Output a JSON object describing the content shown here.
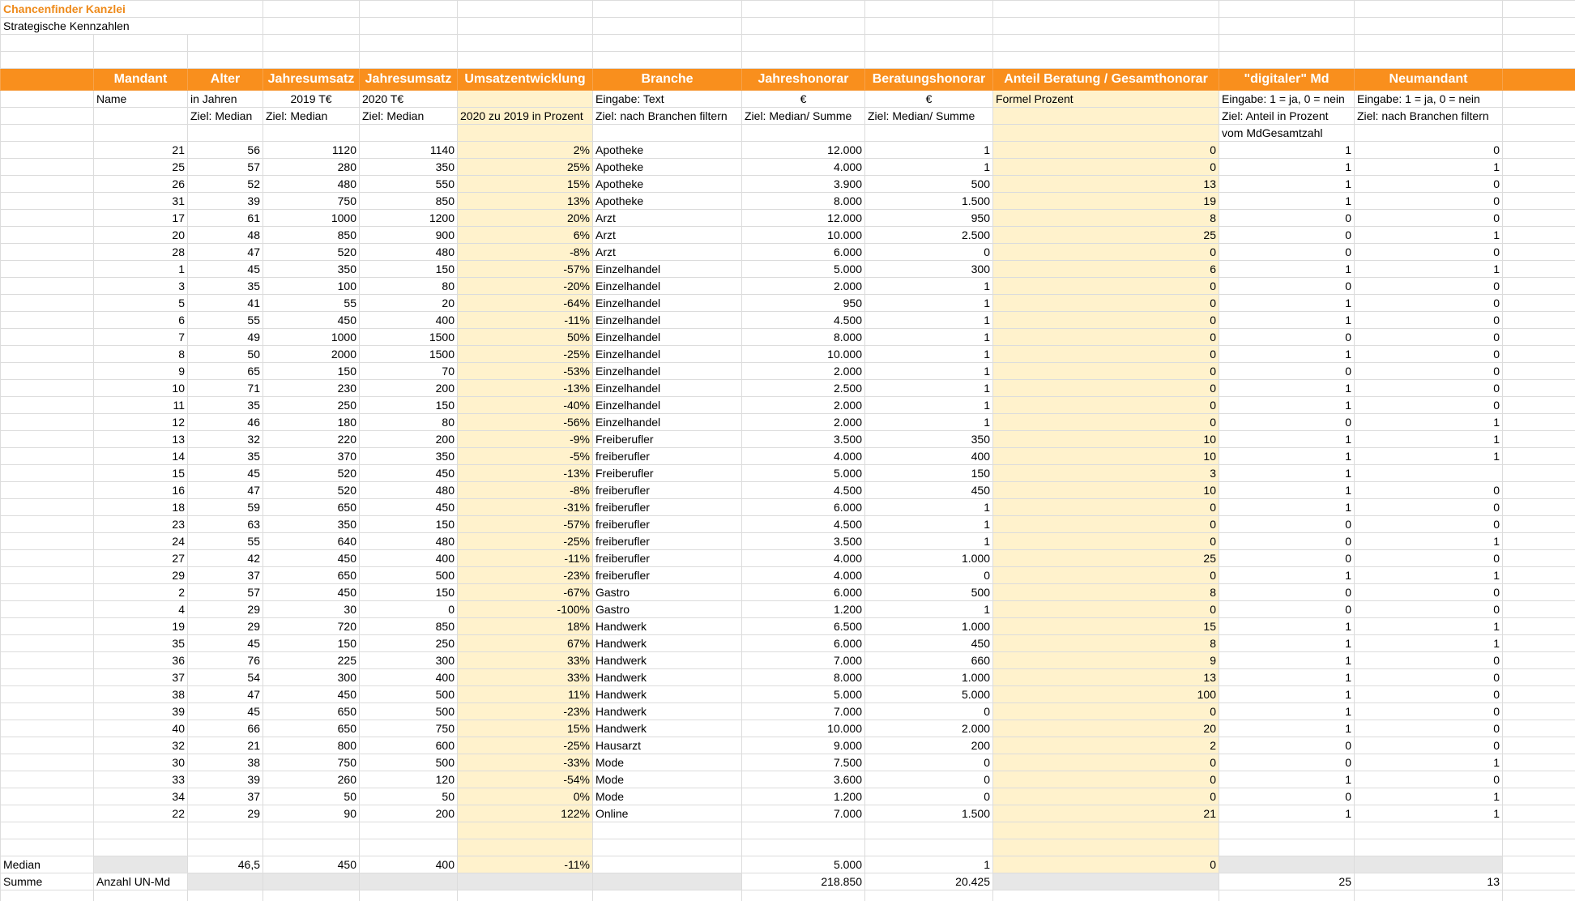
{
  "sheet": {
    "title": "Chancenfinder Kanzlei",
    "subtitle": "Strategische Kennzahlen",
    "headers": [
      "Mandant",
      "Alter",
      "Jahresumsatz",
      "Jahresumsatz",
      "Umsatzentwicklung",
      "Branche",
      "Jahreshonorar",
      "Beratungshonorar",
      "Anteil Beratung / Gesamthonorar",
      "\"digitaler\" Md",
      "Neumandant"
    ],
    "units_row": [
      "Name",
      "in Jahren",
      "2019   T€",
      "2020 T€",
      "",
      "Eingabe: Text",
      "€",
      "€",
      "Formel Prozent",
      "Eingabe: 1 = ja, 0 = nein",
      "Eingabe: 1 = ja, 0 = nein"
    ],
    "target_row": [
      "",
      "Ziel: Median",
      "Ziel: Median",
      "Ziel: Median",
      "2020 zu 2019 in Prozent",
      "Ziel: nach Branchen filtern",
      "Ziel: Median/ Summe",
      "Ziel: Median/ Summe",
      "",
      "Ziel: Anteil in Prozent",
      "Ziel: nach Branchen filtern"
    ],
    "target_row2": [
      "",
      "",
      "",
      "",
      "",
      "",
      "",
      "",
      "",
      "vom MdGesamtzahl",
      ""
    ],
    "rows": [
      [
        "21",
        "56",
        "1120",
        "1140",
        "2%",
        "Apotheke",
        "12.000",
        "1",
        "0",
        "1",
        "0"
      ],
      [
        "25",
        "57",
        "280",
        "350",
        "25%",
        "Apotheke",
        "4.000",
        "1",
        "0",
        "1",
        "1"
      ],
      [
        "26",
        "52",
        "480",
        "550",
        "15%",
        "Apotheke",
        "3.900",
        "500",
        "13",
        "1",
        "0"
      ],
      [
        "31",
        "39",
        "750",
        "850",
        "13%",
        "Apotheke",
        "8.000",
        "1.500",
        "19",
        "1",
        "0"
      ],
      [
        "17",
        "61",
        "1000",
        "1200",
        "20%",
        "Arzt",
        "12.000",
        "950",
        "8",
        "0",
        "0"
      ],
      [
        "20",
        "48",
        "850",
        "900",
        "6%",
        "Arzt",
        "10.000",
        "2.500",
        "25",
        "0",
        "1"
      ],
      [
        "28",
        "47",
        "520",
        "480",
        "-8%",
        "Arzt",
        "6.000",
        "0",
        "0",
        "0",
        "0"
      ],
      [
        "1",
        "45",
        "350",
        "150",
        "-57%",
        "Einzelhandel",
        "5.000",
        "300",
        "6",
        "1",
        "1"
      ],
      [
        "3",
        "35",
        "100",
        "80",
        "-20%",
        "Einzelhandel",
        "2.000",
        "1",
        "0",
        "0",
        "0"
      ],
      [
        "5",
        "41",
        "55",
        "20",
        "-64%",
        "Einzelhandel",
        "950",
        "1",
        "0",
        "1",
        "0"
      ],
      [
        "6",
        "55",
        "450",
        "400",
        "-11%",
        "Einzelhandel",
        "4.500",
        "1",
        "0",
        "1",
        "0"
      ],
      [
        "7",
        "49",
        "1000",
        "1500",
        "50%",
        "Einzelhandel",
        "8.000",
        "1",
        "0",
        "0",
        "0"
      ],
      [
        "8",
        "50",
        "2000",
        "1500",
        "-25%",
        "Einzelhandel",
        "10.000",
        "1",
        "0",
        "1",
        "0"
      ],
      [
        "9",
        "65",
        "150",
        "70",
        "-53%",
        "Einzelhandel",
        "2.000",
        "1",
        "0",
        "0",
        "0"
      ],
      [
        "10",
        "71",
        "230",
        "200",
        "-13%",
        "Einzelhandel",
        "2.500",
        "1",
        "0",
        "1",
        "0"
      ],
      [
        "11",
        "35",
        "250",
        "150",
        "-40%",
        "Einzelhandel",
        "2.000",
        "1",
        "0",
        "1",
        "0"
      ],
      [
        "12",
        "46",
        "180",
        "80",
        "-56%",
        "Einzelhandel",
        "2.000",
        "1",
        "0",
        "0",
        "1"
      ],
      [
        "13",
        "32",
        "220",
        "200",
        "-9%",
        "Freiberufler",
        "3.500",
        "350",
        "10",
        "1",
        "1"
      ],
      [
        "14",
        "35",
        "370",
        "350",
        "-5%",
        "freiberufler",
        "4.000",
        "400",
        "10",
        "1",
        "1"
      ],
      [
        "15",
        "45",
        "520",
        "450",
        "-13%",
        "Freiberufler",
        "5.000",
        "150",
        "3",
        "1",
        ""
      ],
      [
        "16",
        "47",
        "520",
        "480",
        "-8%",
        "freiberufler",
        "4.500",
        "450",
        "10",
        "1",
        "0"
      ],
      [
        "18",
        "59",
        "650",
        "450",
        "-31%",
        "freiberufler",
        "6.000",
        "1",
        "0",
        "1",
        "0"
      ],
      [
        "23",
        "63",
        "350",
        "150",
        "-57%",
        "freiberufler",
        "4.500",
        "1",
        "0",
        "0",
        "0"
      ],
      [
        "24",
        "55",
        "640",
        "480",
        "-25%",
        "freiberufler",
        "3.500",
        "1",
        "0",
        "0",
        "1"
      ],
      [
        "27",
        "42",
        "450",
        "400",
        "-11%",
        "freiberufler",
        "4.000",
        "1.000",
        "25",
        "0",
        "0"
      ],
      [
        "29",
        "37",
        "650",
        "500",
        "-23%",
        "freiberufler",
        "4.000",
        "0",
        "0",
        "1",
        "1"
      ],
      [
        "2",
        "57",
        "450",
        "150",
        "-67%",
        "Gastro",
        "6.000",
        "500",
        "8",
        "0",
        "0"
      ],
      [
        "4",
        "29",
        "30",
        "0",
        "-100%",
        "Gastro",
        "1.200",
        "1",
        "0",
        "0",
        "0"
      ],
      [
        "19",
        "29",
        "720",
        "850",
        "18%",
        "Handwerk",
        "6.500",
        "1.000",
        "15",
        "1",
        "1"
      ],
      [
        "35",
        "45",
        "150",
        "250",
        "67%",
        "Handwerk",
        "6.000",
        "450",
        "8",
        "1",
        "1"
      ],
      [
        "36",
        "76",
        "225",
        "300",
        "33%",
        "Handwerk",
        "7.000",
        "660",
        "9",
        "1",
        "0"
      ],
      [
        "37",
        "54",
        "300",
        "400",
        "33%",
        "Handwerk",
        "8.000",
        "1.000",
        "13",
        "1",
        "0"
      ],
      [
        "38",
        "47",
        "450",
        "500",
        "11%",
        "Handwerk",
        "5.000",
        "5.000",
        "100",
        "1",
        "0"
      ],
      [
        "39",
        "45",
        "650",
        "500",
        "-23%",
        "Handwerk",
        "7.000",
        "0",
        "0",
        "1",
        "0"
      ],
      [
        "40",
        "66",
        "650",
        "750",
        "15%",
        "Handwerk",
        "10.000",
        "2.000",
        "20",
        "1",
        "0"
      ],
      [
        "32",
        "21",
        "800",
        "600",
        "-25%",
        "Hausarzt",
        "9.000",
        "200",
        "2",
        "0",
        "0"
      ],
      [
        "30",
        "38",
        "750",
        "500",
        "-33%",
        "Mode",
        "7.500",
        "0",
        "0",
        "0",
        "1"
      ],
      [
        "33",
        "39",
        "260",
        "120",
        "-54%",
        "Mode",
        "3.600",
        "0",
        "0",
        "1",
        "0"
      ],
      [
        "34",
        "37",
        "50",
        "50",
        "0%",
        "Mode",
        "1.200",
        "0",
        "0",
        "0",
        "1"
      ],
      [
        "22",
        "29",
        "90",
        "200",
        "122%",
        "Online",
        "7.000",
        "1.500",
        "21",
        "1",
        "1"
      ]
    ],
    "median": {
      "label": "Median",
      "alter": "46,5",
      "umsatz2019": "450",
      "umsatz2020": "400",
      "entwicklung": "-11%",
      "jahreshonorar": "5.000",
      "beratungshonorar": "1",
      "anteil": "0"
    },
    "summe": {
      "label": "Summe",
      "anzahl_label": "Anzahl UN-Md",
      "jahreshonorar": "218.850",
      "beratungshonorar": "20.425",
      "digital": "25",
      "neu": "13"
    }
  },
  "colors": {
    "header_orange": "#f98f1d",
    "title_orange": "#ee8a1a",
    "highlight_yellow": "#fff2cc",
    "summary_gray": "#e7e7e7",
    "gridline": "#dcdcdc"
  }
}
